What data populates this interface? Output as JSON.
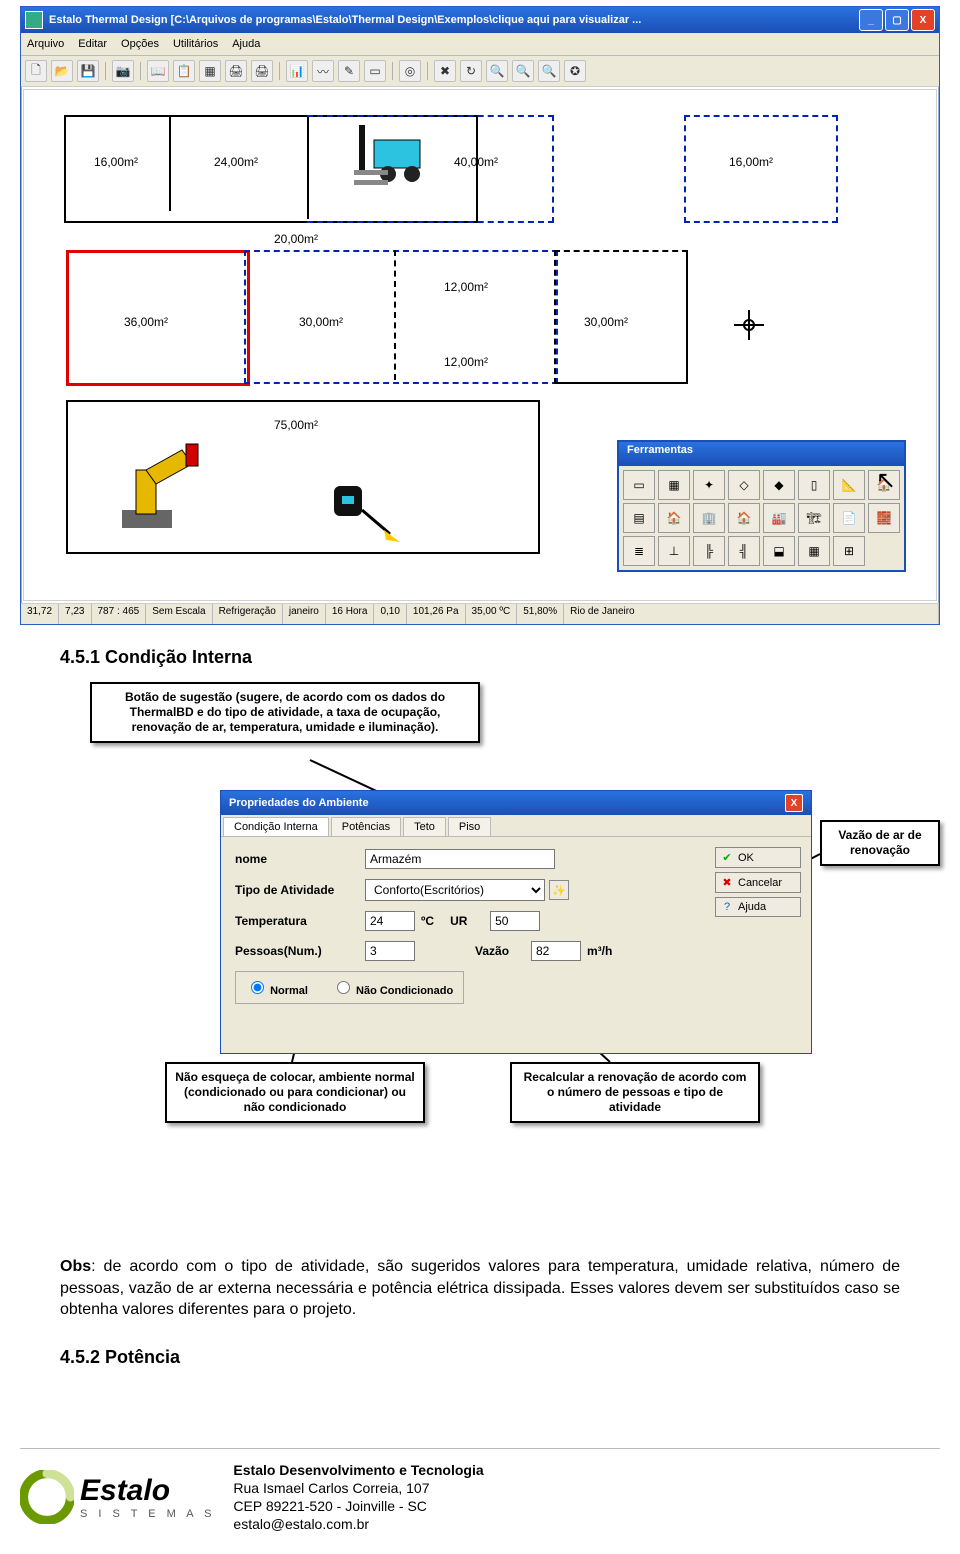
{
  "window": {
    "title": "Estalo Thermal Design [C:\\Arquivos de programas\\Estalo\\Thermal Design\\Exemplos\\clique aqui para visualizar ...",
    "menu": [
      "Arquivo",
      "Editar",
      "Opções",
      "Utilitários",
      "Ajuda"
    ],
    "statusbar": [
      "31,72",
      "7,23",
      "787 : 465",
      "Sem Escala",
      "Refrigeração",
      "janeiro",
      "16 Hora",
      "0,10",
      "101,26 Pa",
      "35,00 ºC",
      "51,80%",
      "Rio de Janeiro"
    ]
  },
  "canvas": {
    "rooms": [
      "16,00m²",
      "24,00m²",
      "40,00m²",
      "16,00m²",
      "20,00m²",
      "36,00m²",
      "30,00m²",
      "12,00m²",
      "30,00m²",
      "12,00m²",
      "75,00m²"
    ]
  },
  "toolbox": {
    "title": "Ferramentas"
  },
  "section1": {
    "heading": "4.5.1 Condição Interna"
  },
  "section2": {
    "heading": "4.5.2 Potência"
  },
  "callouts": {
    "c1": "Botão de sugestão (sugere, de acordo com os dados do ThermalBD e do tipo de atividade, a taxa de ocupação, renovação de ar, temperatura, umidade e iluminação).",
    "c2": "Vazão de ar de renovação",
    "c3": "Não esqueça de colocar, ambiente normal (condicionado ou para condicionar) ou não condicionado",
    "c4": "Recalcular a renovação de acordo com o número de pessoas e tipo de atividade"
  },
  "dialog": {
    "title": "Propriedades do Ambiente",
    "tabs": [
      "Condição Interna",
      "Potências",
      "Teto",
      "Piso"
    ],
    "fields": {
      "nome_label": "nome",
      "nome_value": "Armazém",
      "tipo_label": "Tipo de Atividade",
      "tipo_value": "Conforto(Escritórios)",
      "temp_label": "Temperatura",
      "temp_value": "24",
      "temp_unit": "ºC",
      "ur_label": "UR",
      "ur_value": "50",
      "pess_label": "Pessoas(Num.)",
      "pess_value": "3",
      "vazao_label": "Vazão",
      "vazao_value": "82",
      "vazao_unit": "m³/h",
      "radio1": "Normal",
      "radio2": "Não Condicionado"
    },
    "buttons": {
      "ok": "OK",
      "cancel": "Cancelar",
      "help": "Ajuda"
    }
  },
  "obs": {
    "lead": "Obs",
    "text": ": de acordo com o tipo de atividade, são sugeridos valores para temperatura, umidade relativa, número de pessoas, vazão de ar externa necessária e potência elétrica dissipada. Esses valores devem ser substituídos caso se obtenha valores diferentes para o projeto."
  },
  "footer": {
    "brand": "Estalo",
    "sub": "S I S T E M A S",
    "lines": [
      "Estalo Desenvolvimento e Tecnologia",
      "Rua Ismael Carlos Correia, 107",
      "CEP 89221-520 - Joinville - SC",
      "estalo@estalo.com.br"
    ]
  }
}
